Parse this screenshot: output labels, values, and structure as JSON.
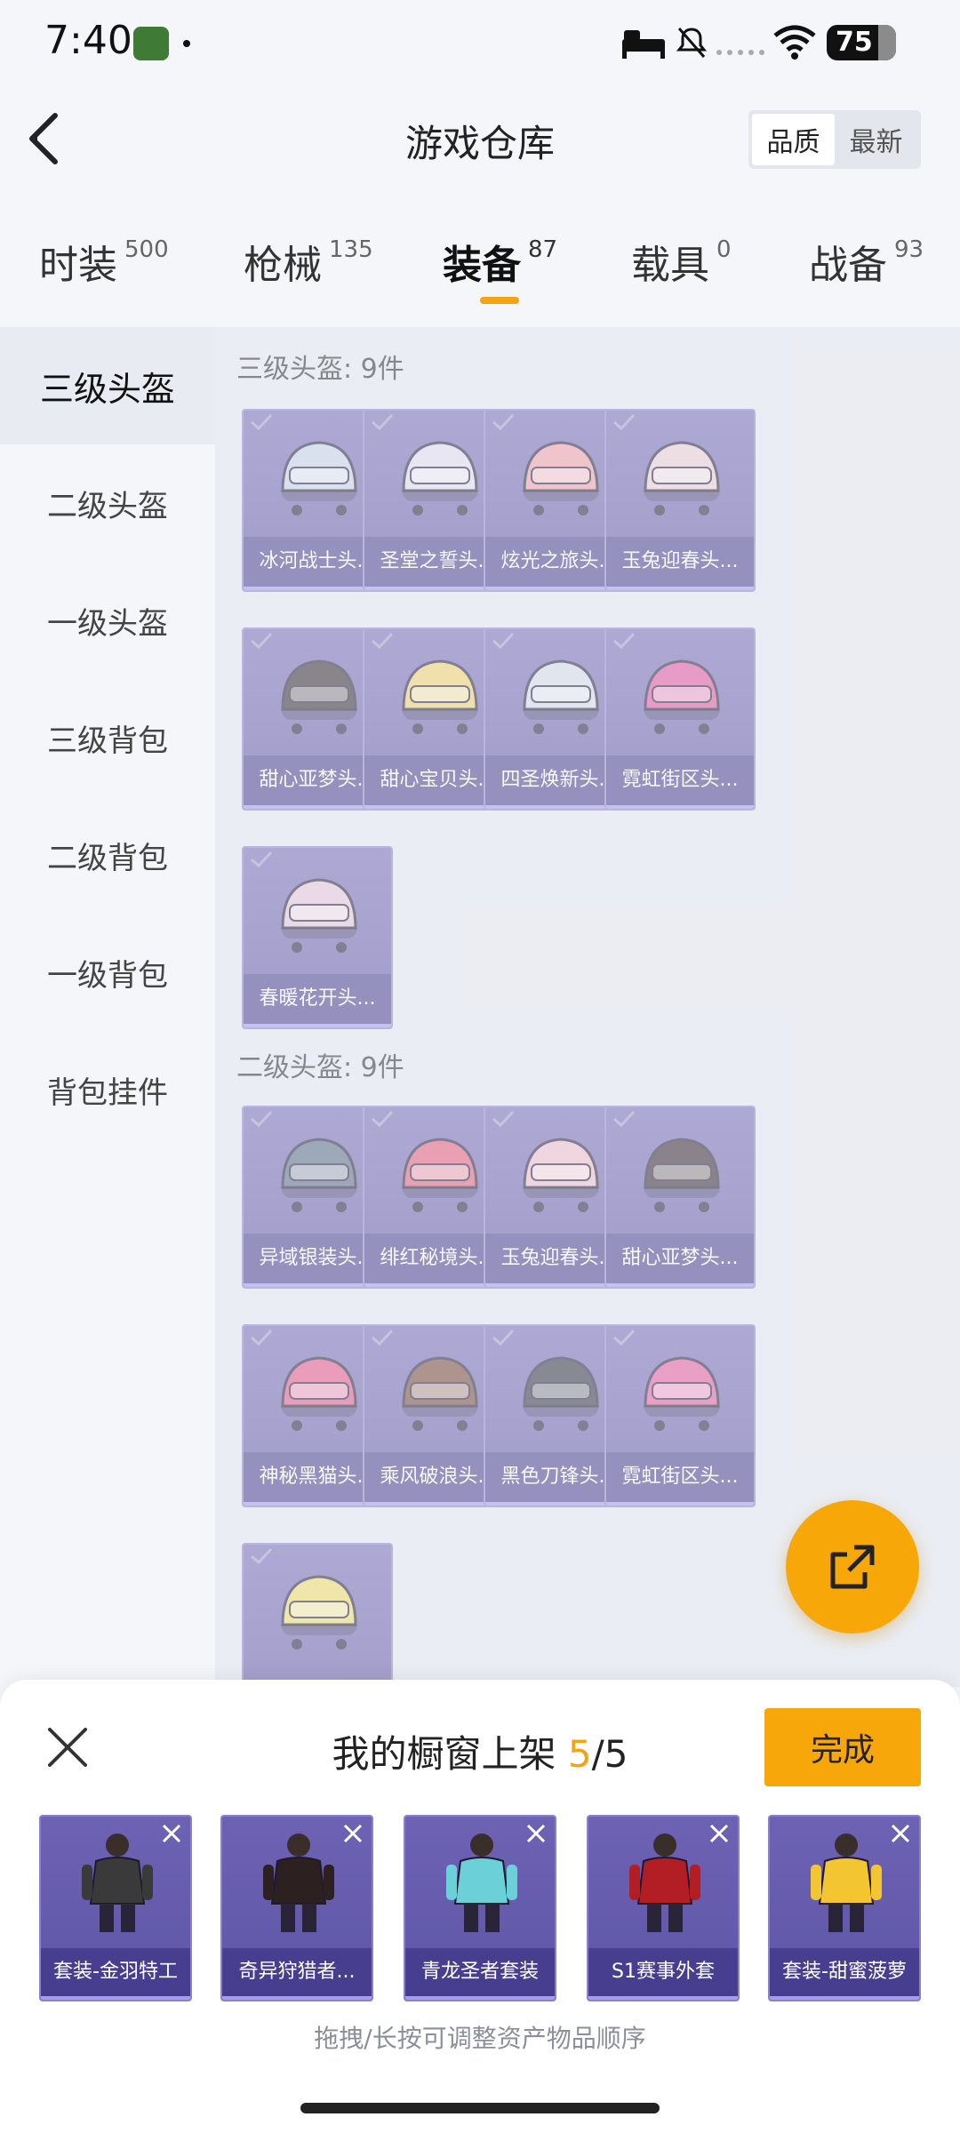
{
  "status_bar": {
    "time": "7:40",
    "battery": "75"
  },
  "header": {
    "title": "游戏仓库",
    "sort": [
      "品质",
      "最新"
    ],
    "active_sort": 0
  },
  "tabs": [
    {
      "label": "时装",
      "count": "500"
    },
    {
      "label": "枪械",
      "count": "135"
    },
    {
      "label": "装备",
      "count": "87"
    },
    {
      "label": "载具",
      "count": "0"
    },
    {
      "label": "战备",
      "count": "93"
    }
  ],
  "active_tab": 2,
  "sidebar": [
    "三级头盔",
    "二级头盔",
    "一级头盔",
    "三级背包",
    "二级背包",
    "一级背包",
    "背包挂件"
  ],
  "active_sidebar": 0,
  "sections": [
    {
      "title": "三级头盔: 9件",
      "items": [
        "冰河战士头...",
        "圣堂之誓头...",
        "炫光之旅头...",
        "玉兔迎春头...",
        "甜心亚梦头...",
        "甜心宝贝头...",
        "四圣焕新头...",
        "霓虹街区头...",
        "春暖花开头..."
      ],
      "colors": [
        "#c9d6ea",
        "#e4dff0",
        "#f2a0a8",
        "#ecd0d4",
        "#3a2c33",
        "#f2d370",
        "#d8dde8",
        "#e2569e",
        "#e8c8d8"
      ]
    },
    {
      "title": "二级头盔: 9件",
      "items": [
        "异域银装头...",
        "绯红秘境头...",
        "玉兔迎春头...",
        "甜心亚梦头...",
        "神秘黑猫头...",
        "乘风破浪头...",
        "黑色刀锋头...",
        "霓虹街区头...",
        ""
      ],
      "colors": [
        "#5a7088",
        "#e6607a",
        "#f0c0c8",
        "#3a2a30",
        "#e55a8a",
        "#7a4a3a",
        "#333842",
        "#e8609e",
        "#f3df6a"
      ]
    }
  ],
  "sheet": {
    "title_prefix": "我的橱窗上架 ",
    "count": "5",
    "total": "/5",
    "done": "完成",
    "items": [
      "套装-金羽特工",
      "奇异狩猎者...",
      "青龙圣者套装",
      "S1赛事外套",
      "套装-甜蜜菠萝"
    ],
    "colors": [
      "#3a3a3a",
      "#2c2020",
      "#6bd0d8",
      "#b21e24",
      "#f2c531"
    ],
    "hint": "拖拽/长按可调整资产物品顺序"
  }
}
